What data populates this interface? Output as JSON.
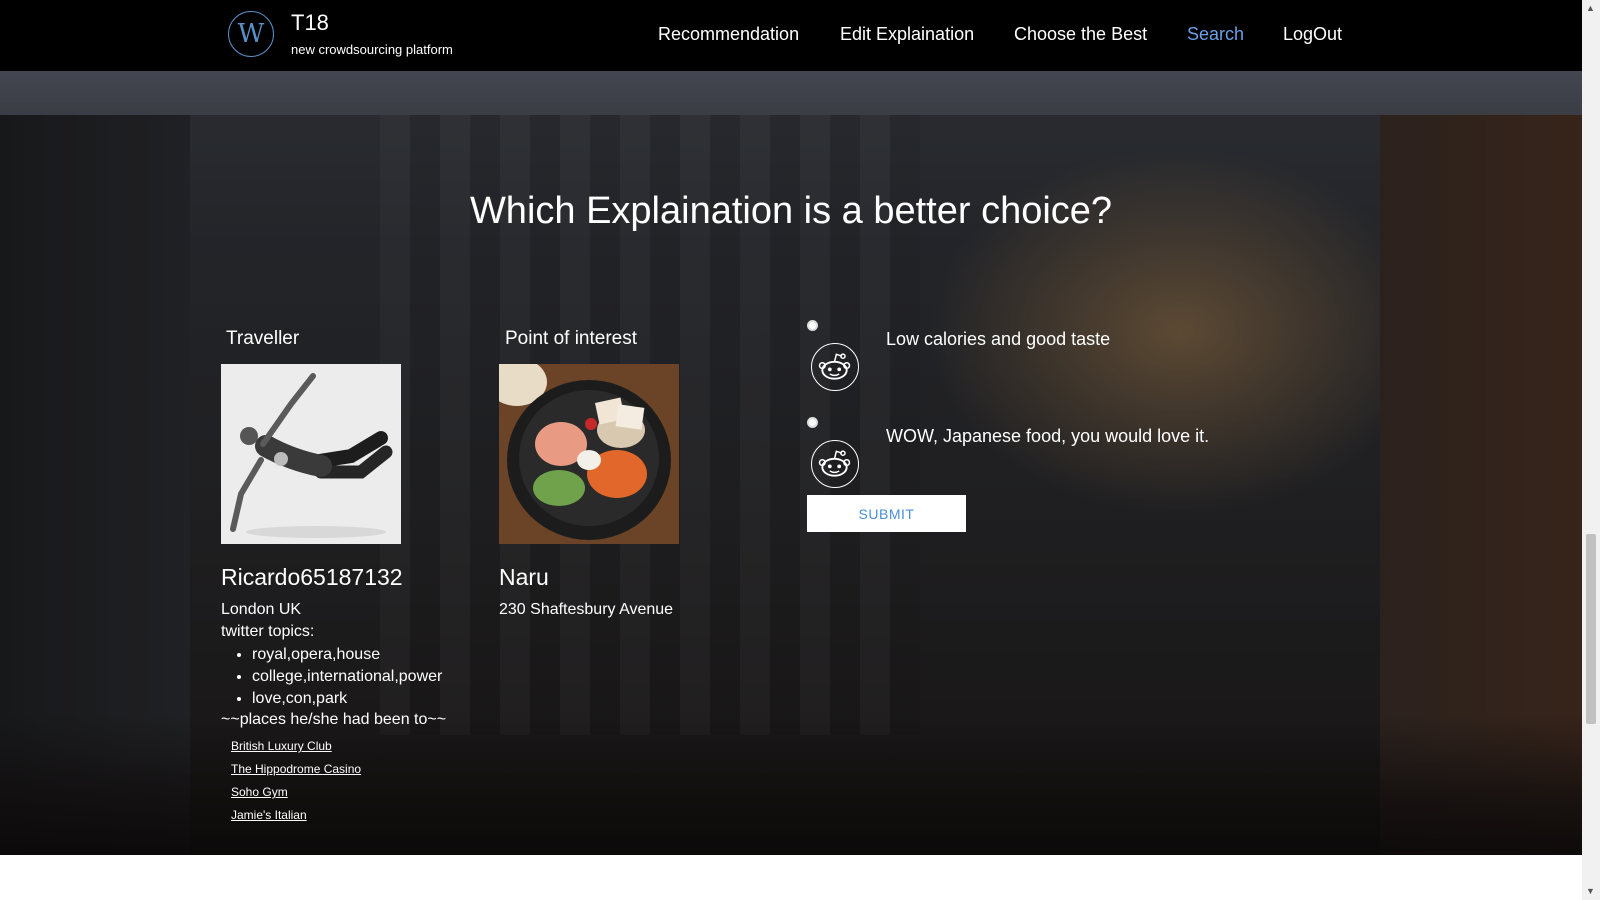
{
  "nav": {
    "logo_letter": "W",
    "title": "T18",
    "subtitle": "new crowdsourcing platform",
    "links": [
      "Recommendation",
      "Edit Explaination",
      "Choose the Best",
      "Search",
      "LogOut"
    ],
    "active_link": "Search",
    "active_color": "#6aa0e6"
  },
  "page": {
    "heading": "Which Explaination is a better choice?"
  },
  "traveller": {
    "label": "Traveller",
    "name": "Ricardo65187132",
    "location": "London UK",
    "topics_label": "twitter topics:",
    "topics": [
      "royal,opera,house",
      "college,international,power",
      "love,con,park"
    ],
    "places_label": "~~places he/she had been to~~",
    "places": [
      "British Luxury Club",
      "The Hippodrome Casino",
      "Soho Gym",
      "Jamie's Italian"
    ]
  },
  "poi": {
    "label": "Point of interest",
    "name": "Naru",
    "address": "230 Shaftesbury Avenue"
  },
  "options": [
    {
      "text": "Low calories and good taste",
      "icon": "reddit-icon"
    },
    {
      "text": "WOW, Japanese food, you would love it.",
      "icon": "reddit-icon"
    }
  ],
  "submit_label": "SUBMIT"
}
